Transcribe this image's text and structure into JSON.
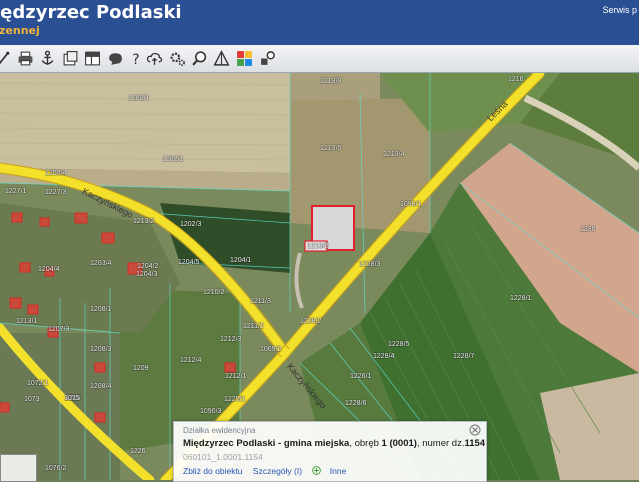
{
  "header": {
    "title": "iędzyrzec Podlaski",
    "subtitle": "zennej",
    "top_link": "Serwis p"
  },
  "toolbar": {
    "tools": [
      "pan-icon",
      "print-icon",
      "anchor-icon",
      "export-icon",
      "layout-icon",
      "shape-icon",
      "help-icon",
      "upload-icon",
      "settings-icon",
      "search-zoom-icon",
      "measure-icon",
      "layers-color-icon",
      "identify-icon"
    ]
  },
  "map": {
    "parcels": [
      "1213/3",
      "1216",
      "1202/1",
      "1202/1",
      "1213/5",
      "1213/4",
      "1213/2",
      "1202/4",
      "1227/1",
      "1090/1",
      "1230",
      "1227/3",
      "1213/2",
      "1202/3",
      "1204/5",
      "1204/4",
      "1203/4",
      "1204/3",
      "1204/2",
      "1204/1",
      "1211/3",
      "1211/2",
      "1210/2",
      "1228/3",
      "1228/2",
      "1209",
      "1207/3",
      "1208/1",
      "1208/3",
      "1208/4",
      "1215",
      "1212/4",
      "1212/3",
      "1212/1",
      "1213/1",
      "1228/1",
      "1226/1",
      "1228/5",
      "1228/4",
      "1228/7",
      "1228/6",
      "1072/1",
      "1073",
      "1075",
      "1076/2",
      "1069/2",
      "1090/3",
      "1225/1",
      "1226"
    ],
    "streets": [
      "Kaczyńskiego",
      "Leśna",
      "Kaczyńskiego"
    ]
  },
  "popup": {
    "title": "Działka ewidencyjna",
    "location": "Międzyrzec Podlaski - gmina miejska",
    "obreb_text": ", obręb ",
    "obreb_value": "1 (0001)",
    "number_text": ", numer dz.",
    "number_value": "1154",
    "parcel_id": "060101_1.0001.1154",
    "links": {
      "zoom": "Zbliż do obiektu",
      "details": "Szczegóły (I)",
      "more": "Inne"
    }
  },
  "colors": {
    "header_bg": "#2b4f93",
    "subtitle": "#f0b43a",
    "road": "#f2e02a",
    "link": "#2a56b3",
    "selected_parcel": "#e0202a"
  }
}
